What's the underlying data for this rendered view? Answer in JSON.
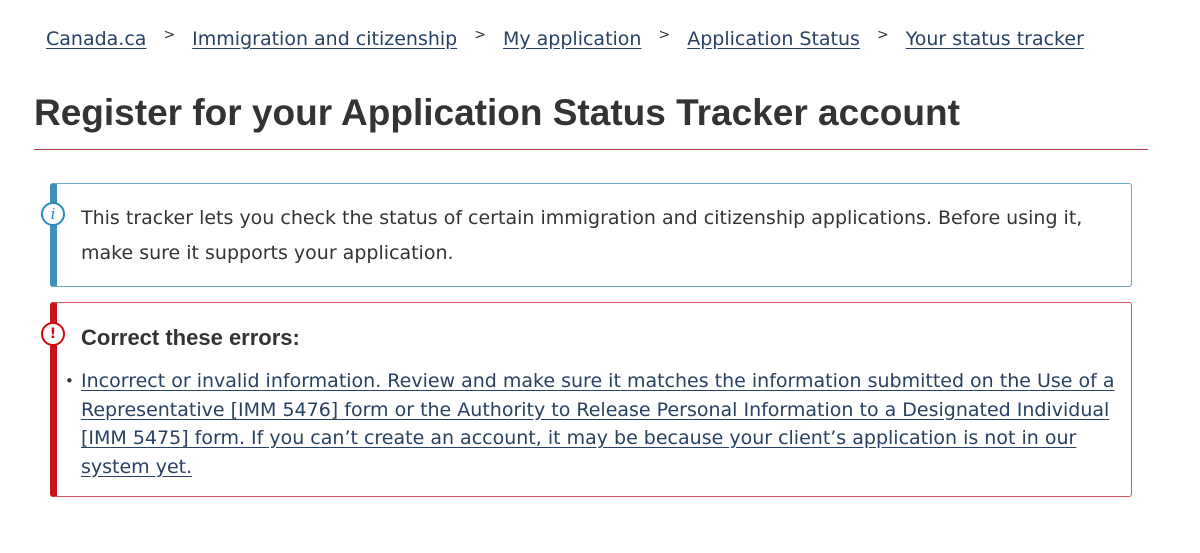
{
  "breadcrumb": {
    "items": [
      {
        "label": "Canada.ca"
      },
      {
        "label": "Immigration and citizenship"
      },
      {
        "label": "My application"
      },
      {
        "label": "Application Status"
      },
      {
        "label": "Your status tracker"
      }
    ],
    "separator": ">"
  },
  "page": {
    "title": "Register for your Application Status Tracker account"
  },
  "info_alert": {
    "icon": "info-icon",
    "icon_glyph": "i",
    "text": "This tracker lets you check the status of certain immigration and citizenship applications. Before using it, make sure it supports your application.",
    "accent_color": "#2b8cc4"
  },
  "error_alert": {
    "icon": "exclamation-icon",
    "icon_glyph": "!",
    "heading": "Correct these errors:",
    "errors": [
      {
        "text": "Incorrect or invalid information. Review and make sure it matches the information submitted on the Use of a Representative [IMM 5476] form or the Authority to Release Personal Information to a Designated Individual [IMM 5475] form. If you can’t create an account, it may be because your client’s application is not in our system yet."
      }
    ],
    "accent_color": "#d3080c"
  },
  "colors": {
    "link": "#284162",
    "title_rule": "#af3c43",
    "text": "#333333"
  }
}
